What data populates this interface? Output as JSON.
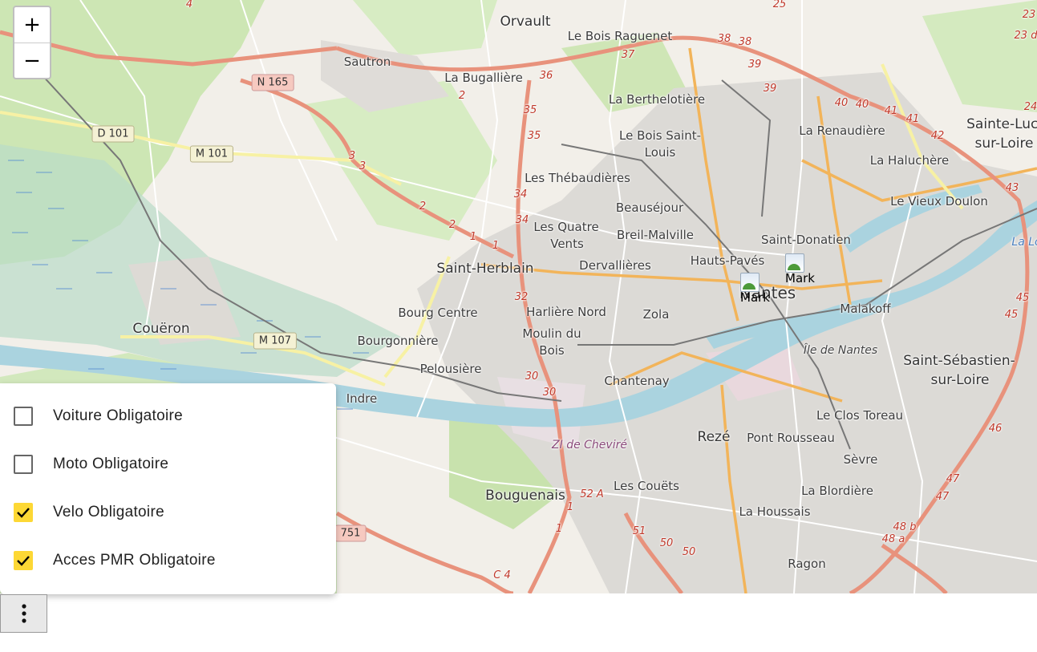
{
  "map": {
    "zoom_in": "+",
    "zoom_out": "−",
    "places": [
      "Orvault",
      "Le Bois Raguenet",
      "Sautron",
      "La Bugallière",
      "La Berthelotière",
      "Le Bois Saint-",
      "Louis",
      "Les Thébaudières",
      "Beauséjour",
      "Les Quatre",
      "Vents",
      "Breil-Malville",
      "Saint-Herblain",
      "Dervallières",
      "Hauts-Pavés",
      "Saint-Donatien",
      "Nantes",
      "La Renaudière",
      "La Haluchère",
      "Sainte-Luce",
      "sur-Loire",
      "Le Vieux Doulon",
      "Malakoff",
      "Bourg Centre",
      "Harlière Nord",
      "Moulin du",
      "Bois",
      "Zola",
      "Couëron",
      "Bourgonnière",
      "Pelousière",
      "Chantenay",
      "Indre",
      "Saint-Sébastien-",
      "sur-Loire",
      "Le Clos Toreau",
      "Rezé",
      "Pont Rousseau",
      "Sèvre",
      "Bouguenais",
      "Les Couëts",
      "La Blordière",
      "La Houssais",
      "Ragon"
    ],
    "italic_places": [
      "Île de Nantes",
      "ZI de Cheviré"
    ],
    "river_label": "La Lo",
    "shields": {
      "n165": "N 165",
      "d101": "D 101",
      "m101": "M 101",
      "m107": "M 107",
      "s751": "751"
    },
    "road_numbers": [
      "4",
      "25",
      "23",
      "23 d",
      "38",
      "38",
      "37",
      "36",
      "39",
      "39",
      "40",
      "40",
      "41",
      "41",
      "42",
      "43",
      "2",
      "35",
      "35",
      "3",
      "3",
      "2",
      "2",
      "34",
      "34",
      "1",
      "1",
      "32",
      "30",
      "30",
      "52 A",
      "1",
      "1",
      "C 4",
      "51",
      "50",
      "50",
      "48 b",
      "48 a",
      "47",
      "47",
      "46",
      "45",
      "45",
      "24"
    ],
    "markers": [
      {
        "label": "Mark"
      },
      {
        "label": "Mark"
      }
    ]
  },
  "filters": [
    {
      "label": "Voiture Obligatoire",
      "checked": false
    },
    {
      "label": "Moto Obligatoire",
      "checked": false
    },
    {
      "label": "Velo Obligatoire",
      "checked": true
    },
    {
      "label": "Acces PMR Obligatoire",
      "checked": true
    }
  ],
  "colors": {
    "checkbox_on": "#fdd835",
    "water": "#aad3df",
    "river": "#aad3df",
    "forest": "#add19e"
  },
  "menu_icon": "vertical-dots-icon"
}
